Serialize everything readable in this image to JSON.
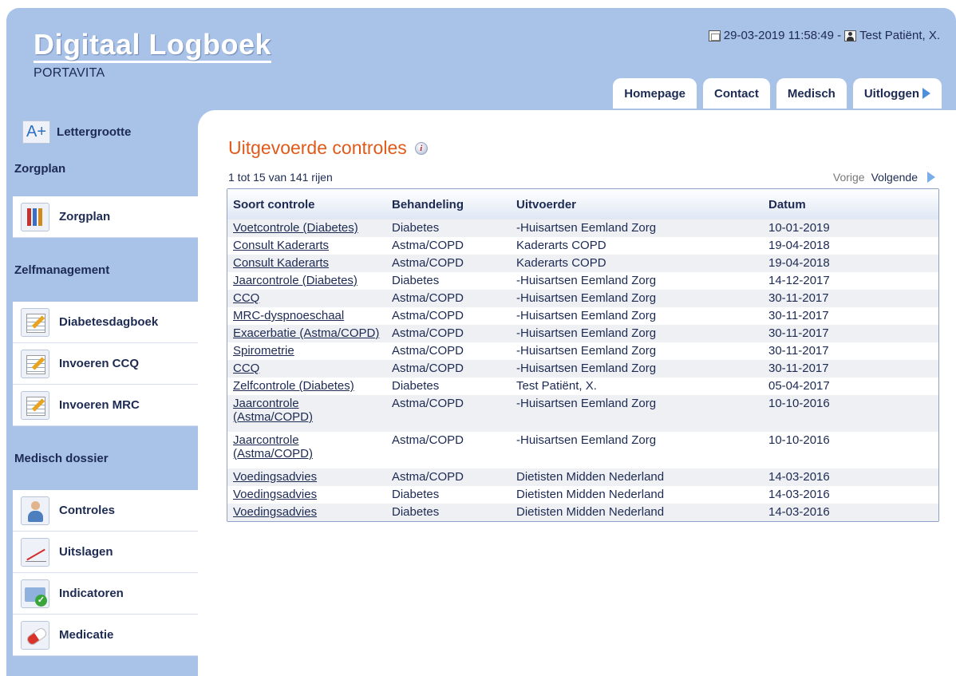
{
  "header": {
    "title": "Digitaal Logboek",
    "subtitle": "PORTAVITA",
    "datetime": "29-03-2019 11:58:49 -",
    "user": "Test Patiënt, X."
  },
  "tabs": [
    {
      "label": "Homepage"
    },
    {
      "label": "Contact"
    },
    {
      "label": "Medisch"
    },
    {
      "label": "Uitloggen"
    }
  ],
  "sidebar": {
    "font_size_label": "Lettergrootte",
    "font_size_icon": "A+",
    "sections": [
      {
        "title": "Zorgplan",
        "items": [
          {
            "label": "Zorgplan",
            "icon": "books-icon"
          }
        ]
      },
      {
        "title": "Zelfmanagement",
        "items": [
          {
            "label": "Diabetesdagboek",
            "icon": "notepad-pencil-icon"
          },
          {
            "label": "Invoeren CCQ",
            "icon": "notepad-pencil-icon"
          },
          {
            "label": "Invoeren MRC",
            "icon": "notepad-pencil-icon"
          }
        ]
      },
      {
        "title": "Medisch dossier",
        "items": [
          {
            "label": "Controles",
            "icon": "doctor-icon"
          },
          {
            "label": "Uitslagen",
            "icon": "line-chart-icon"
          },
          {
            "label": "Indicatoren",
            "icon": "folder-check-icon"
          },
          {
            "label": "Medicatie",
            "icon": "pills-icon"
          }
        ]
      }
    ]
  },
  "main": {
    "title": "Uitgevoerde controles",
    "row_count": "1 tot 15 van 141 rijen",
    "pager": {
      "prev": "Vorige",
      "next": "Volgende"
    },
    "table": {
      "columns": [
        "Soort controle",
        "Behandeling",
        "Uitvoerder",
        "Datum"
      ],
      "rows": [
        [
          "Voetcontrole (Diabetes)",
          "Diabetes",
          "-Huisartsen Eemland Zorg",
          "10-01-2019"
        ],
        [
          "Consult Kaderarts",
          "Astma/COPD",
          "Kaderarts COPD",
          "19-04-2018"
        ],
        [
          "Consult Kaderarts",
          "Astma/COPD",
          "Kaderarts COPD",
          "19-04-2018"
        ],
        [
          "Jaarcontrole (Diabetes)",
          "Diabetes",
          "-Huisartsen Eemland Zorg",
          "14-12-2017"
        ],
        [
          "CCQ",
          "Astma/COPD",
          "-Huisartsen Eemland Zorg",
          "30-11-2017"
        ],
        [
          "MRC-dyspnoeschaal",
          "Astma/COPD",
          "-Huisartsen Eemland Zorg",
          "30-11-2017"
        ],
        [
          "Exacerbatie (Astma/COPD)",
          "Astma/COPD",
          "-Huisartsen Eemland Zorg",
          "30-11-2017"
        ],
        [
          "Spirometrie",
          "Astma/COPD",
          "-Huisartsen Eemland Zorg",
          "30-11-2017"
        ],
        [
          "CCQ",
          "Astma/COPD",
          "-Huisartsen Eemland Zorg",
          "30-11-2017"
        ],
        [
          "Zelfcontrole (Diabetes)",
          "Diabetes",
          "Test Patiënt, X.",
          "05-04-2017"
        ],
        [
          "Jaarcontrole (Astma/COPD)",
          "Astma/COPD",
          "-Huisartsen Eemland Zorg",
          "10-10-2016"
        ],
        [
          "Jaarcontrole (Astma/COPD)",
          "Astma/COPD",
          "-Huisartsen Eemland Zorg",
          "10-10-2016"
        ],
        [
          "Voedingsadvies",
          "Astma/COPD",
          "Dietisten Midden Nederland",
          "14-03-2016"
        ],
        [
          "Voedingsadvies",
          "Diabetes",
          "Dietisten Midden Nederland",
          "14-03-2016"
        ],
        [
          "Voedingsadvies",
          "Diabetes",
          "Dietisten Midden Nederland",
          "14-03-2016"
        ]
      ]
    }
  },
  "colors": {
    "frame": "#a9c2e8",
    "title_accent": "#e05a1a",
    "text": "#1d2a52"
  }
}
